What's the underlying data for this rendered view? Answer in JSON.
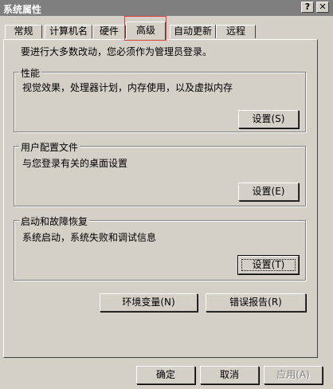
{
  "window": {
    "title": "系统属性",
    "help_glyph": "?",
    "close_glyph": "✕"
  },
  "tabs": [
    {
      "label": "常规"
    },
    {
      "label": "计算机名"
    },
    {
      "label": "硬件"
    },
    {
      "label": "高级",
      "active": true
    },
    {
      "label": "自动更新"
    },
    {
      "label": "远程"
    }
  ],
  "intro": "要进行大多数改动，您必须作为管理员登录。",
  "performance": {
    "label": "性能",
    "desc": "视觉效果，处理器计划，内存使用，以及虚拟内存",
    "button": "设置(S)"
  },
  "profiles": {
    "label": "用户配置文件",
    "desc": "与您登录有关的桌面设置",
    "button": "设置(E)"
  },
  "startup": {
    "label": "启动和故障恢复",
    "desc": "系统启动，系统失败和调试信息",
    "button": "设置(T)"
  },
  "env_button": "环境变量(N)",
  "error_button": "错误报告(R)",
  "footer": {
    "ok": "确定",
    "cancel": "取消",
    "apply": "应用(A)"
  },
  "colors": {
    "titlebar": "#7f7f7f",
    "face": "#d4d0c8",
    "highlight_box": "#e0403c"
  }
}
